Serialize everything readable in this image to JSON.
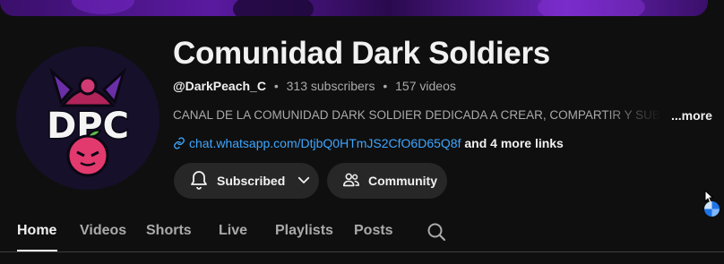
{
  "channel": {
    "name": "Comunidad Dark Soldiers",
    "handle": "@DarkPeach_C",
    "subscribers": "313 subscribers",
    "videos": "157 videos",
    "separator": "•",
    "description": "CANAL DE LA COMUNIDAD DARK SOLDIER DEDICADA A CREAR, COMPARTIR Y SUBIR CONTENIDO",
    "more_label": "...more",
    "link_url": "chat.whatsapp.com/DtjbQ0HTmJS2CfO6D65Q8f",
    "more_links": "and 4 more links",
    "avatar_text": "DPC"
  },
  "actions": {
    "subscribed_label": "Subscribed",
    "community_label": "Community"
  },
  "tabs": [
    {
      "label": "Home",
      "active": true
    },
    {
      "label": "Videos",
      "active": false
    },
    {
      "label": "Shorts",
      "active": false
    },
    {
      "label": "Live",
      "active": false
    },
    {
      "label": "Playlists",
      "active": false
    },
    {
      "label": "Posts",
      "active": false
    }
  ],
  "icons": {
    "link": "link-icon",
    "bell": "bell-icon",
    "chevron": "chevron-down-icon",
    "community": "people-icon",
    "search": "search-icon"
  },
  "colors": {
    "background": "#0f0f0f",
    "link": "#3ea6ff",
    "button": "#272727",
    "text_secondary": "#aaaaaa"
  }
}
